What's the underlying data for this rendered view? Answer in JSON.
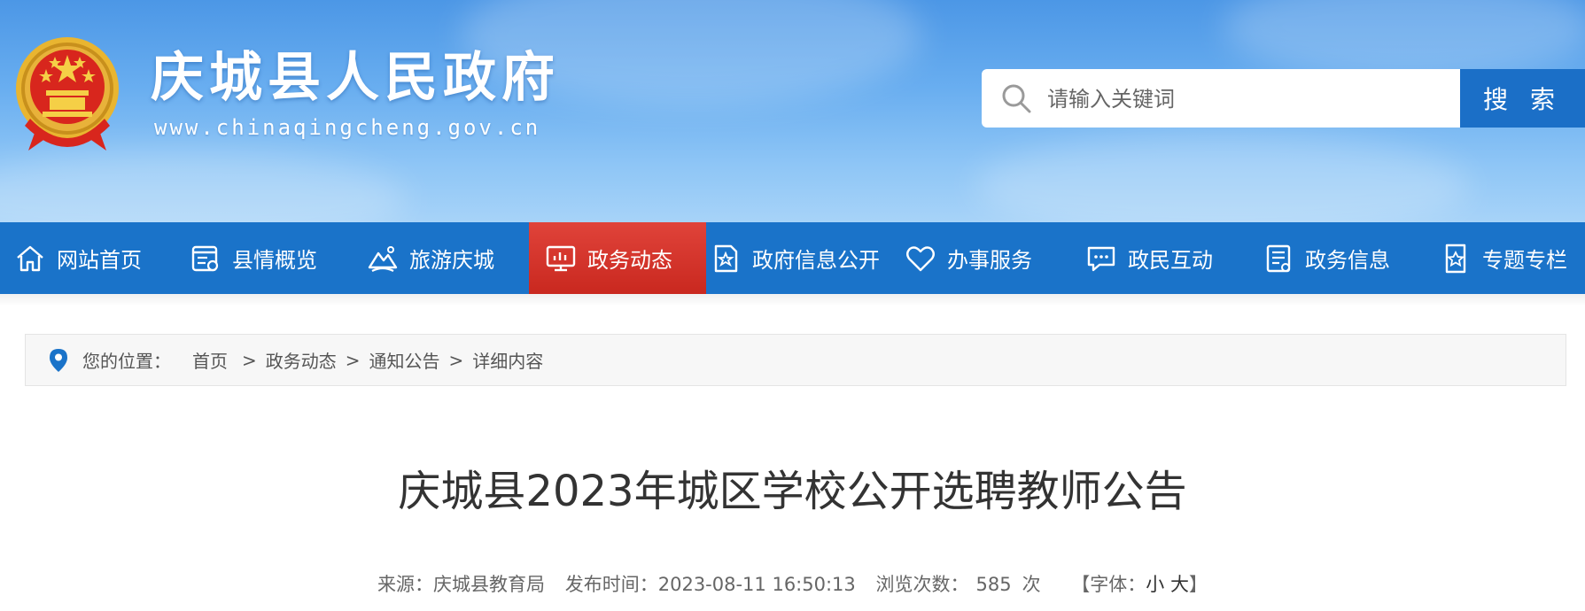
{
  "header": {
    "site_title": "庆城县人民政府",
    "site_url": "www.chinaqingcheng.gov.cn",
    "search": {
      "placeholder": "请输入关键词",
      "button_label": "搜 索"
    }
  },
  "nav": {
    "items": [
      {
        "label": "网站首页",
        "icon": "home-icon"
      },
      {
        "label": "县情概览",
        "icon": "document-icon"
      },
      {
        "label": "旅游庆城",
        "icon": "mountain-icon"
      },
      {
        "label": "政务动态",
        "icon": "monitor-chart-icon",
        "active": true
      },
      {
        "label": "政府信息公开",
        "icon": "star-document-icon"
      },
      {
        "label": "办事服务",
        "icon": "heart-hand-icon"
      },
      {
        "label": "政民互动",
        "icon": "chat-icon"
      },
      {
        "label": "政务信息",
        "icon": "clipboard-icon"
      },
      {
        "label": "专题专栏",
        "icon": "star-badge-icon"
      }
    ],
    "active_color": "#d9342b",
    "bar_color": "#1a73c9"
  },
  "breadcrumb": {
    "label": "您的位置：",
    "items": [
      "首页",
      "政务动态",
      "通知公告",
      "详细内容"
    ],
    "separator": ">"
  },
  "article": {
    "title": "庆城县2023年城区学校公开选聘教师公告",
    "source_label": "来源：",
    "source": "庆城县教育局",
    "publish_label": "发布时间：",
    "publish_time": "2023-08-11 16:50:13",
    "views_label": "浏览次数：",
    "views": "585",
    "views_unit": "次",
    "font_label": "【字体：",
    "font_small": "小",
    "font_large": "大",
    "font_close": "】"
  }
}
